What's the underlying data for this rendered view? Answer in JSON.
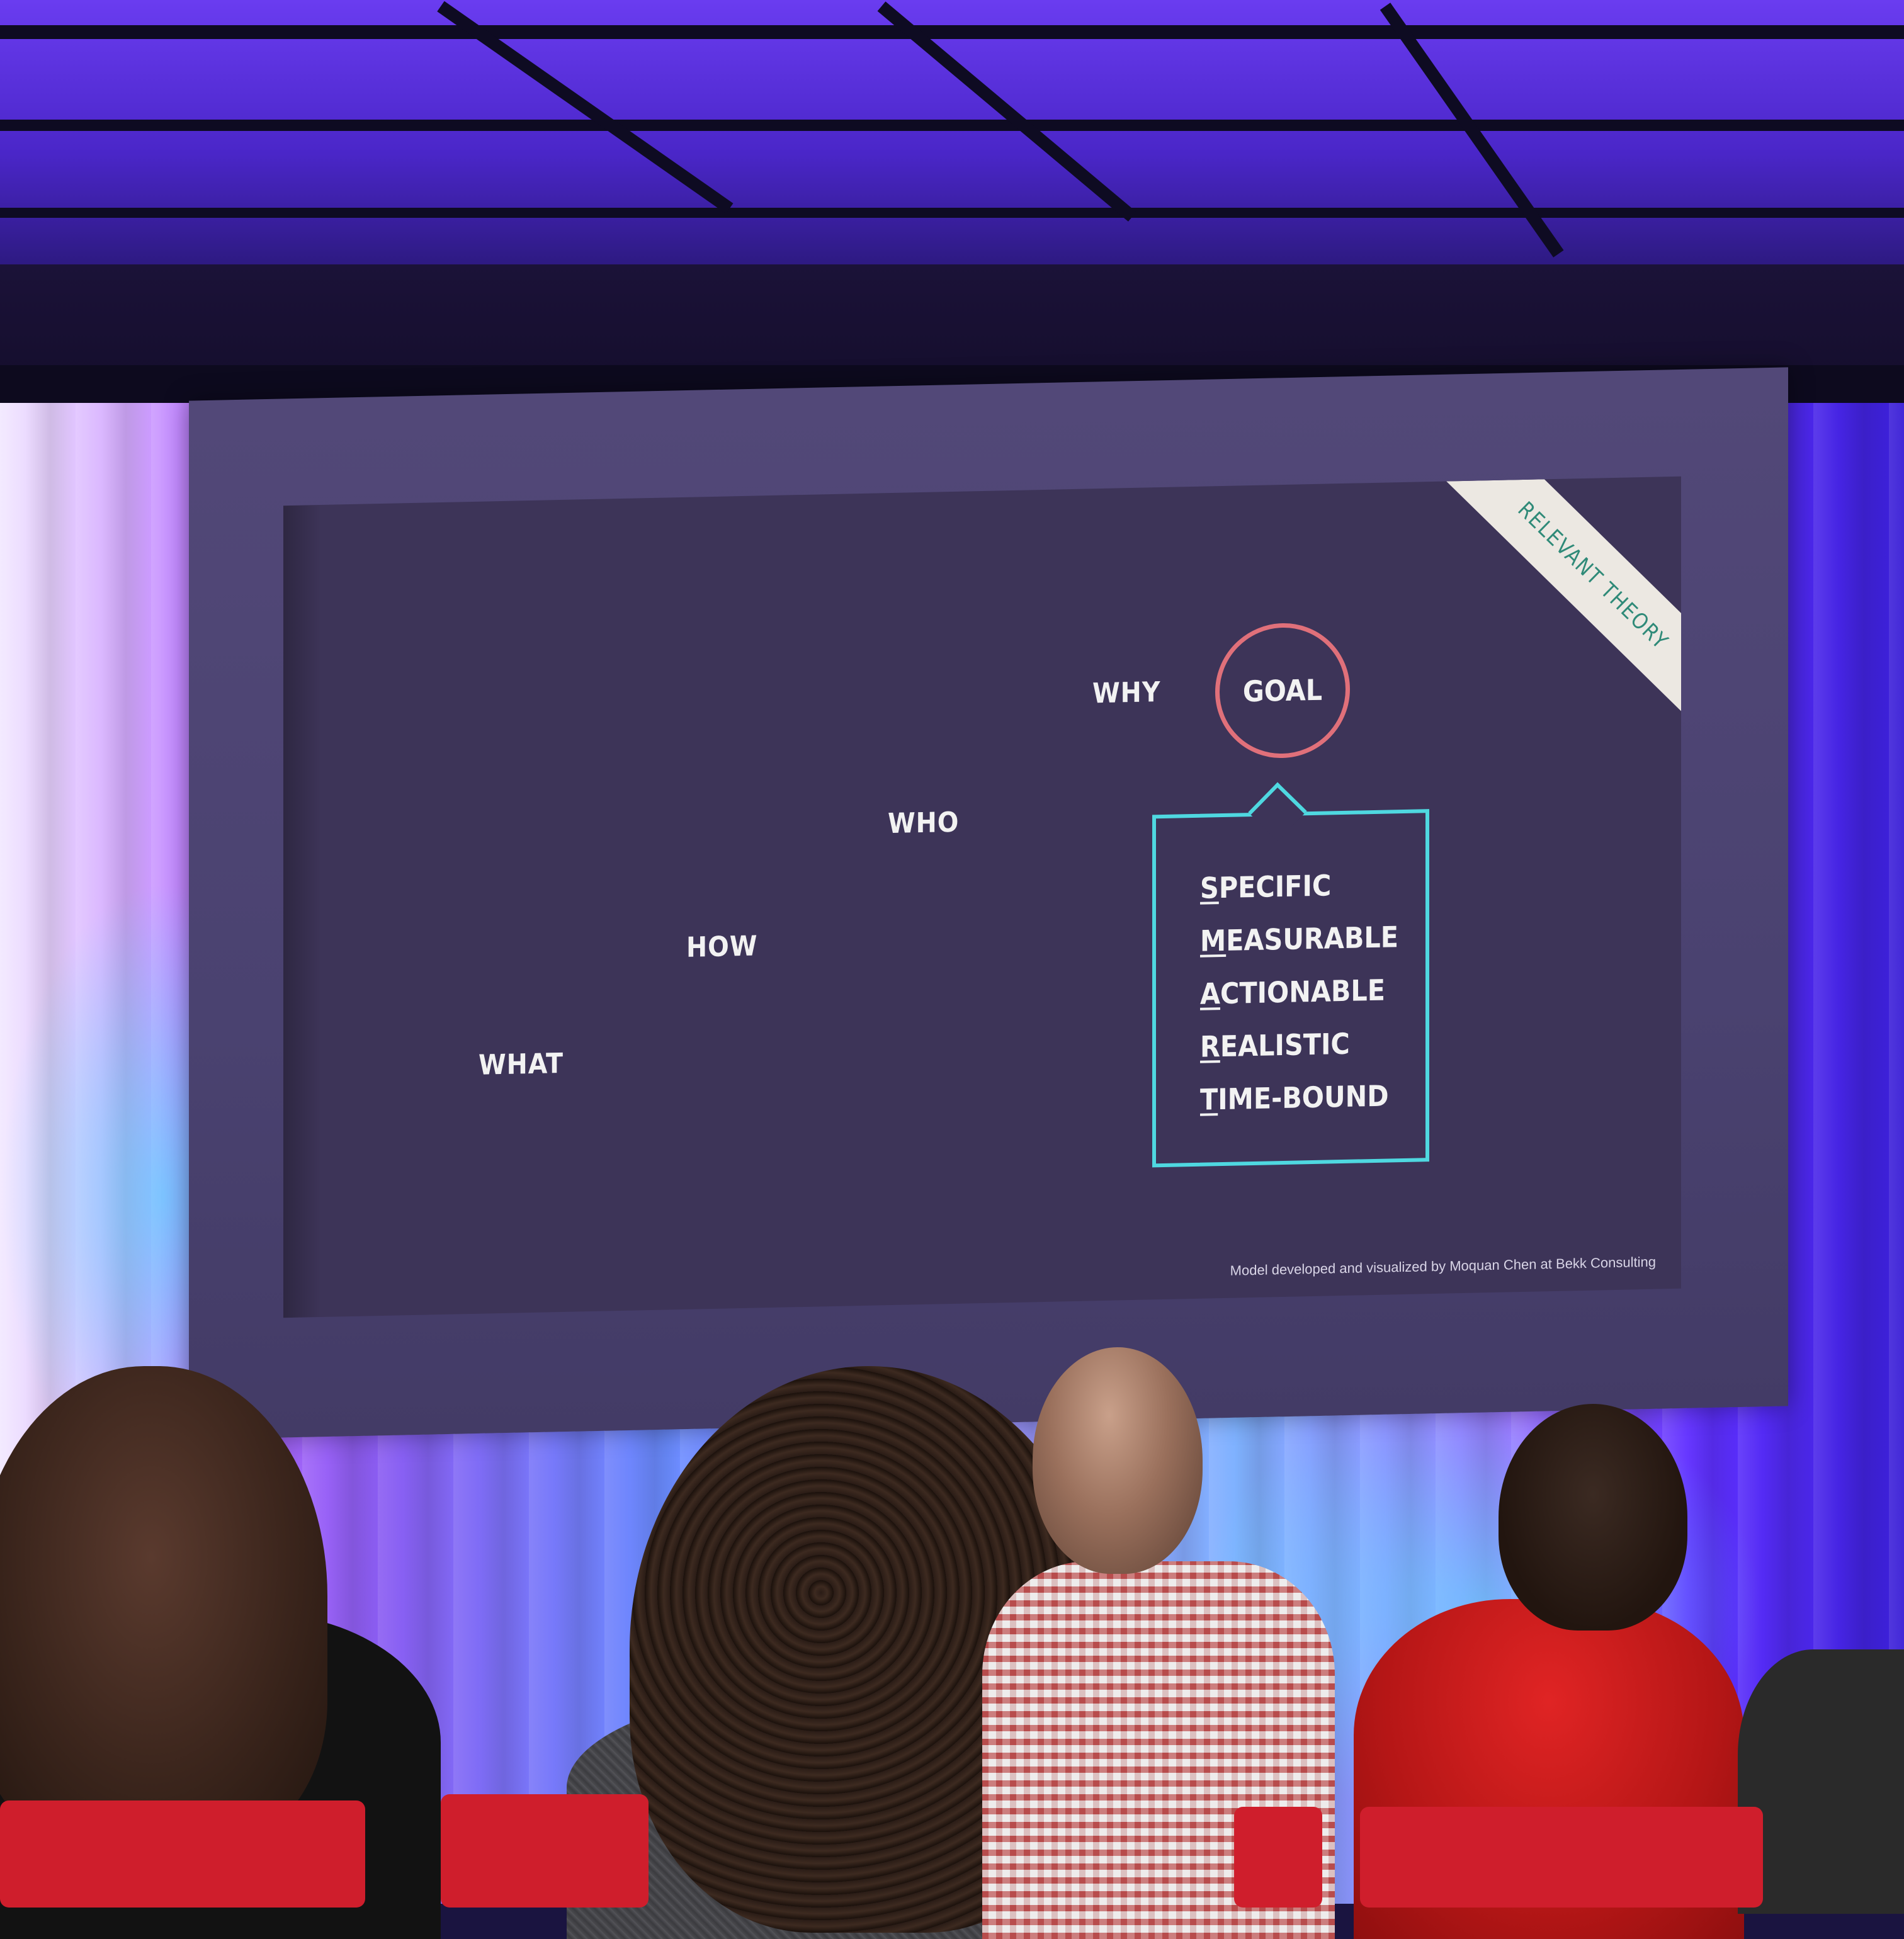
{
  "slide": {
    "corner_ribbon": "RELEVANT THEORY",
    "words": {
      "why": "WHY",
      "who": "WHO",
      "how": "HOW",
      "what": "WHAT"
    },
    "goal_label": "GOAL",
    "smart": [
      {
        "first": "S",
        "rest": "PECIFIC"
      },
      {
        "first": "M",
        "rest": "EASURABLE"
      },
      {
        "first": "A",
        "rest": "CTIONABLE"
      },
      {
        "first": "R",
        "rest": "EALISTIC"
      },
      {
        "first": "T",
        "rest": "IME-BOUND"
      }
    ],
    "credit": "Model developed and visualized by Moquan Chen at Bekk Consulting"
  },
  "colors": {
    "slide_background": "#3d3458",
    "goal_circle": "#e0707a",
    "smart_box_border": "#4fd8e0",
    "ribbon_text": "#2f8a78"
  }
}
